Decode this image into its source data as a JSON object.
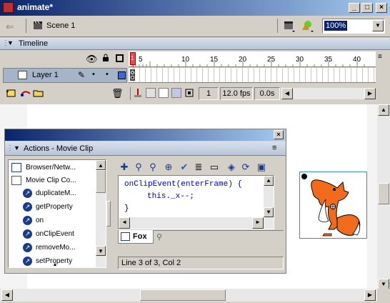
{
  "window": {
    "title": "animate*"
  },
  "scene": {
    "label": "Scene 1",
    "zoom": "100%"
  },
  "timeline": {
    "header": "Timeline",
    "layer_name": "Layer 1",
    "ruler": [
      "1",
      "5",
      "10",
      "15",
      "20",
      "25",
      "30",
      "35",
      "40"
    ],
    "current_frame": "1",
    "fps": "12.0 fps",
    "time": "0.0s"
  },
  "actions": {
    "title": "Actions - Movie Clip",
    "tree": [
      {
        "label": "Browser/Netw...",
        "level": 0,
        "icon": "book-icon"
      },
      {
        "label": "Movie Clip Co...",
        "level": 0,
        "icon": "book-open-icon"
      },
      {
        "label": "duplicateM...",
        "level": 1,
        "icon": "action-icon"
      },
      {
        "label": "getProperty",
        "level": 1,
        "icon": "action-icon"
      },
      {
        "label": "on",
        "level": 1,
        "icon": "action-icon"
      },
      {
        "label": "onClipEvent",
        "level": 1,
        "icon": "action-icon"
      },
      {
        "label": "removeMo...",
        "level": 1,
        "icon": "action-icon"
      },
      {
        "label": "setProperty",
        "level": 1,
        "icon": "action-icon"
      }
    ],
    "code_lines": [
      {
        "text": "onClipEvent(enterFrame) {",
        "indent": 0,
        "color": "#0000c0"
      },
      {
        "text": "this._x--;",
        "indent": 1,
        "color": "#0000c0"
      },
      {
        "text": "}",
        "indent": 0,
        "color": "#000000"
      }
    ],
    "tab_label": "Fox",
    "status": "Line 3 of 3, Col 2"
  },
  "colors": {
    "title_bar": "#0a246a",
    "selection": "#0a246a",
    "keyword": "#0000c0",
    "fox": "#f26a1b"
  }
}
